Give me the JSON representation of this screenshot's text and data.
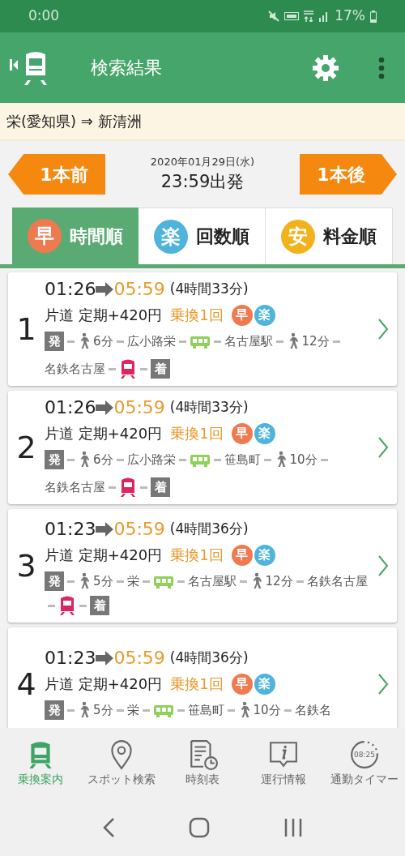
{
  "status_bar": {
    "time": "0:00",
    "battery": "17%"
  },
  "app_bar": {
    "title": "検索結果"
  },
  "route": "栄(愛知県) ⇒ 新清洲",
  "date_nav": {
    "prev": "1本前",
    "date": "2020年01月29日(水)",
    "departure": "23:59出発",
    "next": "1本後"
  },
  "tabs": [
    {
      "badge": "早",
      "label": "時間順",
      "selected": true,
      "color": "#ef7a4f"
    },
    {
      "badge": "楽",
      "label": "回数順",
      "selected": false,
      "color": "#4fb4dc"
    },
    {
      "badge": "安",
      "label": "料金順",
      "selected": false,
      "color": "#f2b21b"
    }
  ],
  "results": [
    {
      "number": "1",
      "depart": "01:26",
      "arrive": "05:59",
      "duration": "(4時間33分)",
      "fare": "片道 定期+420円",
      "transfers": "乗換1回",
      "badges": [
        "早",
        "楽"
      ],
      "segments": [
        {
          "kind": "depart",
          "text": "発"
        },
        {
          "kind": "walk",
          "text": "6分"
        },
        {
          "kind": "station",
          "text": "広小路栄"
        },
        {
          "kind": "bus"
        },
        {
          "kind": "station",
          "text": "名古屋駅"
        },
        {
          "kind": "walk",
          "text": "12分"
        },
        {
          "kind": "station",
          "text": "名鉄名古屋"
        },
        {
          "kind": "train"
        },
        {
          "kind": "arrive",
          "text": "着"
        }
      ]
    },
    {
      "number": "2",
      "depart": "01:26",
      "arrive": "05:59",
      "duration": "(4時間33分)",
      "fare": "片道 定期+420円",
      "transfers": "乗換1回",
      "badges": [
        "早",
        "楽"
      ],
      "segments": [
        {
          "kind": "depart",
          "text": "発"
        },
        {
          "kind": "walk",
          "text": "6分"
        },
        {
          "kind": "station",
          "text": "広小路栄"
        },
        {
          "kind": "bus"
        },
        {
          "kind": "station",
          "text": "笹島町"
        },
        {
          "kind": "walk",
          "text": "10分"
        },
        {
          "kind": "station",
          "text": "名鉄名古屋"
        },
        {
          "kind": "train"
        },
        {
          "kind": "arrive",
          "text": "着"
        }
      ]
    },
    {
      "number": "3",
      "depart": "01:23",
      "arrive": "05:59",
      "duration": "(4時間36分)",
      "fare": "片道 定期+420円",
      "transfers": "乗換1回",
      "badges": [
        "早",
        "楽"
      ],
      "segments": [
        {
          "kind": "depart",
          "text": "発"
        },
        {
          "kind": "walk",
          "text": "5分"
        },
        {
          "kind": "station",
          "text": "栄"
        },
        {
          "kind": "bus"
        },
        {
          "kind": "station",
          "text": "名古屋駅"
        },
        {
          "kind": "walk",
          "text": "12分"
        },
        {
          "kind": "station",
          "text": "名鉄名古屋"
        },
        {
          "kind": "train"
        },
        {
          "kind": "arrive",
          "text": "着"
        }
      ]
    },
    {
      "number": "4",
      "depart": "01:23",
      "arrive": "05:59",
      "duration": "(4時間36分)",
      "fare": "片道 定期+420円",
      "transfers": "乗換1回",
      "badges": [
        "早",
        "楽"
      ],
      "segments": [
        {
          "kind": "depart",
          "text": "発"
        },
        {
          "kind": "walk",
          "text": "5分"
        },
        {
          "kind": "station",
          "text": "栄"
        },
        {
          "kind": "bus"
        },
        {
          "kind": "station",
          "text": "笹島町"
        },
        {
          "kind": "walk",
          "text": "10分"
        },
        {
          "kind": "station",
          "text": "名鉄名"
        }
      ]
    }
  ],
  "bottom_nav": [
    {
      "kind": "train",
      "label": "乗換案内",
      "selected": true
    },
    {
      "kind": "pin",
      "label": "スポット検索",
      "selected": false
    },
    {
      "kind": "timetable",
      "label": "時刻表",
      "selected": false
    },
    {
      "kind": "info",
      "label": "運行情報",
      "selected": false
    },
    {
      "kind": "timer",
      "label": "通勤タイマー",
      "clock": "08:25",
      "selected": false
    }
  ]
}
